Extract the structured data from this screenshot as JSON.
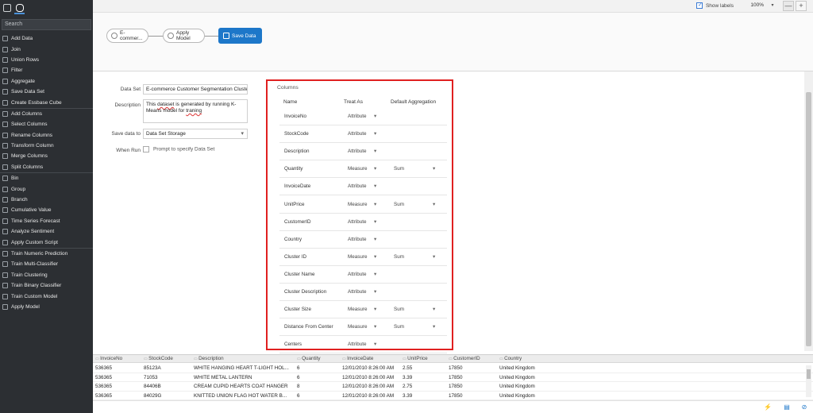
{
  "sidebar": {
    "search_placeholder": "Search",
    "items": [
      {
        "label": "Add Data",
        "icon": "add-data-icon"
      },
      {
        "label": "Join",
        "icon": "join-icon"
      },
      {
        "label": "Union Rows",
        "icon": "union-rows-icon"
      },
      {
        "label": "Filter",
        "icon": "filter-icon"
      },
      {
        "label": "Aggregate",
        "icon": "aggregate-icon"
      },
      {
        "label": "Save Data Set",
        "icon": "save-data-set-icon"
      },
      {
        "label": "Create Essbase Cube",
        "icon": "cube-icon"
      },
      {
        "label": "Add Columns",
        "icon": "add-columns-icon"
      },
      {
        "label": "Select Columns",
        "icon": "select-columns-icon"
      },
      {
        "label": "Rename Columns",
        "icon": "rename-columns-icon"
      },
      {
        "label": "Transform Column",
        "icon": "transform-column-icon"
      },
      {
        "label": "Merge Columns",
        "icon": "merge-columns-icon"
      },
      {
        "label": "Split Columns",
        "icon": "split-columns-icon"
      },
      {
        "label": "Bin",
        "icon": "bin-icon"
      },
      {
        "label": "Group",
        "icon": "group-icon"
      },
      {
        "label": "Branch",
        "icon": "branch-icon"
      },
      {
        "label": "Cumulative Value",
        "icon": "cumulative-value-icon"
      },
      {
        "label": "Time Series Forecast",
        "icon": "time-series-icon"
      },
      {
        "label": "Analyze Sentiment",
        "icon": "sentiment-icon"
      },
      {
        "label": "Apply Custom Script",
        "icon": "script-icon"
      },
      {
        "label": "Train Numeric Prediction",
        "icon": "train-numeric-icon"
      },
      {
        "label": "Train Multi-Classifier",
        "icon": "train-multi-icon"
      },
      {
        "label": "Train Clustering",
        "icon": "train-clustering-icon"
      },
      {
        "label": "Train Binary Classifier",
        "icon": "train-binary-icon"
      },
      {
        "label": "Train Custom Model",
        "icon": "train-custom-icon"
      },
      {
        "label": "Apply Model",
        "icon": "apply-model-icon"
      }
    ]
  },
  "toolbar": {
    "show_labels": "Show labels",
    "zoom": "100%",
    "zoom_out": "—",
    "zoom_in": "+"
  },
  "flow": {
    "nodes": [
      {
        "label": "E-commer..."
      },
      {
        "label": "Apply Model"
      },
      {
        "label": "Save Data"
      }
    ]
  },
  "properties": {
    "dataset_label": "Data Set",
    "dataset_value": "E-commerce Customer Segmentation Cluste",
    "description_label": "Description",
    "description_part1": "This ",
    "description_word1": "dataset",
    "description_part2": " is generated by running K-Means model for ",
    "description_word2": "traning",
    "save_to_label": "Save data to",
    "save_to_value": "Data Set Storage",
    "when_run_label": "When Run",
    "when_run_value": "Prompt to specify Data Set"
  },
  "columns": {
    "title": "Columns",
    "headers": {
      "name": "Name",
      "treat_as": "Treat As",
      "aggregation": "Default Aggregation"
    },
    "rows": [
      {
        "name": "InvoiceNo",
        "treat": "Attribute",
        "agg": ""
      },
      {
        "name": "StockCode",
        "treat": "Attribute",
        "agg": ""
      },
      {
        "name": "Description",
        "treat": "Attribute",
        "agg": ""
      },
      {
        "name": "Quantity",
        "treat": "Measure",
        "agg": "Sum"
      },
      {
        "name": "InvoiceDate",
        "treat": "Attribute",
        "agg": ""
      },
      {
        "name": "UnitPrice",
        "treat": "Measure",
        "agg": "Sum"
      },
      {
        "name": "CustomerID",
        "treat": "Attribute",
        "agg": ""
      },
      {
        "name": "Country",
        "treat": "Attribute",
        "agg": ""
      },
      {
        "name": "Cluster ID",
        "treat": "Measure",
        "agg": "Sum"
      },
      {
        "name": "Cluster Name",
        "treat": "Attribute",
        "agg": ""
      },
      {
        "name": "Cluster Description",
        "treat": "Attribute",
        "agg": ""
      },
      {
        "name": "Cluster Size",
        "treat": "Measure",
        "agg": "Sum"
      },
      {
        "name": "Distance From Center",
        "treat": "Measure",
        "agg": "Sum"
      },
      {
        "name": "Centers",
        "treat": "Attribute",
        "agg": ""
      }
    ]
  },
  "grid": {
    "headers": [
      "InvoiceNo",
      "StockCode",
      "Description",
      "Quantity",
      "InvoiceDate",
      "UnitPrice",
      "CustomerID",
      "Country"
    ],
    "rows": [
      [
        "536365",
        "85123A",
        "WHITE HANGING HEART T-LIGHT HOL...",
        "6",
        "12/01/2010 8:26:00 AM",
        "2.55",
        "17850",
        "United Kingdom"
      ],
      [
        "536365",
        "71053",
        "WHITE METAL LANTERN",
        "6",
        "12/01/2010 8:26:00 AM",
        "3.39",
        "17850",
        "United Kingdom"
      ],
      [
        "536365",
        "84406B",
        "CREAM CUPID HEARTS COAT HANGER",
        "8",
        "12/01/2010 8:26:00 AM",
        "2.75",
        "17850",
        "United Kingdom"
      ],
      [
        "536365",
        "84029G",
        "KNITTED UNION FLAG HOT WATER B...",
        "6",
        "12/01/2010 8:26:00 AM",
        "3.39",
        "17850",
        "United Kingdom"
      ]
    ]
  },
  "colors": {
    "accent": "#1d77c9",
    "sidebar_bg": "#2c2f33",
    "highlight": "#e02020"
  }
}
